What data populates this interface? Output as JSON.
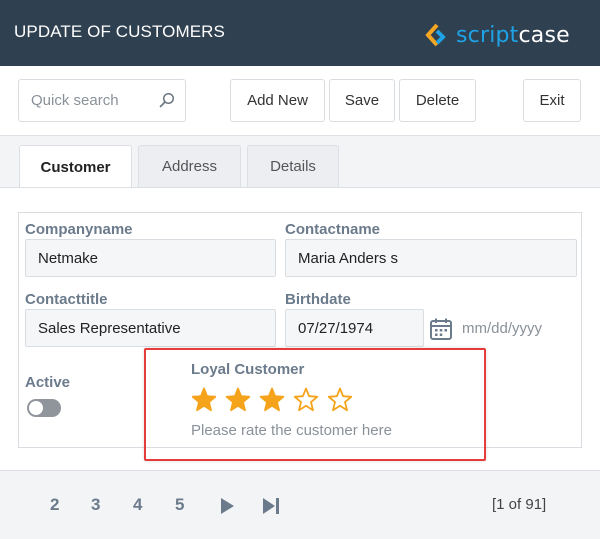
{
  "header": {
    "title": "UPDATE OF CUSTOMERS",
    "logo": {
      "part1": "script",
      "part2": "case",
      "accent_color": "#1fa3e6",
      "chevron_colors": [
        "#f5a623",
        "#1fa3e6"
      ]
    }
  },
  "toolbar": {
    "search": {
      "placeholder": "Quick search",
      "icon": "search-icon"
    },
    "add_new_label": "Add New",
    "save_label": "Save",
    "delete_label": "Delete",
    "exit_label": "Exit"
  },
  "tabs": [
    {
      "label": "Customer",
      "active": true
    },
    {
      "label": "Address",
      "active": false
    },
    {
      "label": "Details",
      "active": false
    }
  ],
  "form": {
    "companyname": {
      "label": "Companyname",
      "value": "Netmake"
    },
    "contactname": {
      "label": "Contactname",
      "value": "Maria Anders s"
    },
    "contacttitle": {
      "label": "Contacttitle",
      "value": "Sales Representative"
    },
    "birthdate": {
      "label": "Birthdate",
      "value": "07/27/1974",
      "format_hint": "mm/dd/yyyy",
      "icon": "calendar-icon"
    },
    "active": {
      "label": "Active",
      "checked": false
    },
    "loyal_customer": {
      "label": "Loyal Customer",
      "rating": 3,
      "max_rating": 5,
      "hint": "Please rate the customer here",
      "star_color": "#f5a31a"
    }
  },
  "pagination": {
    "pages": [
      "2",
      "3",
      "4",
      "5"
    ],
    "info": "[1 of 91]"
  },
  "colors": {
    "header_bg": "#2f4050",
    "highlight_border": "#e53b3b",
    "label_color": "#6b7b8c"
  }
}
